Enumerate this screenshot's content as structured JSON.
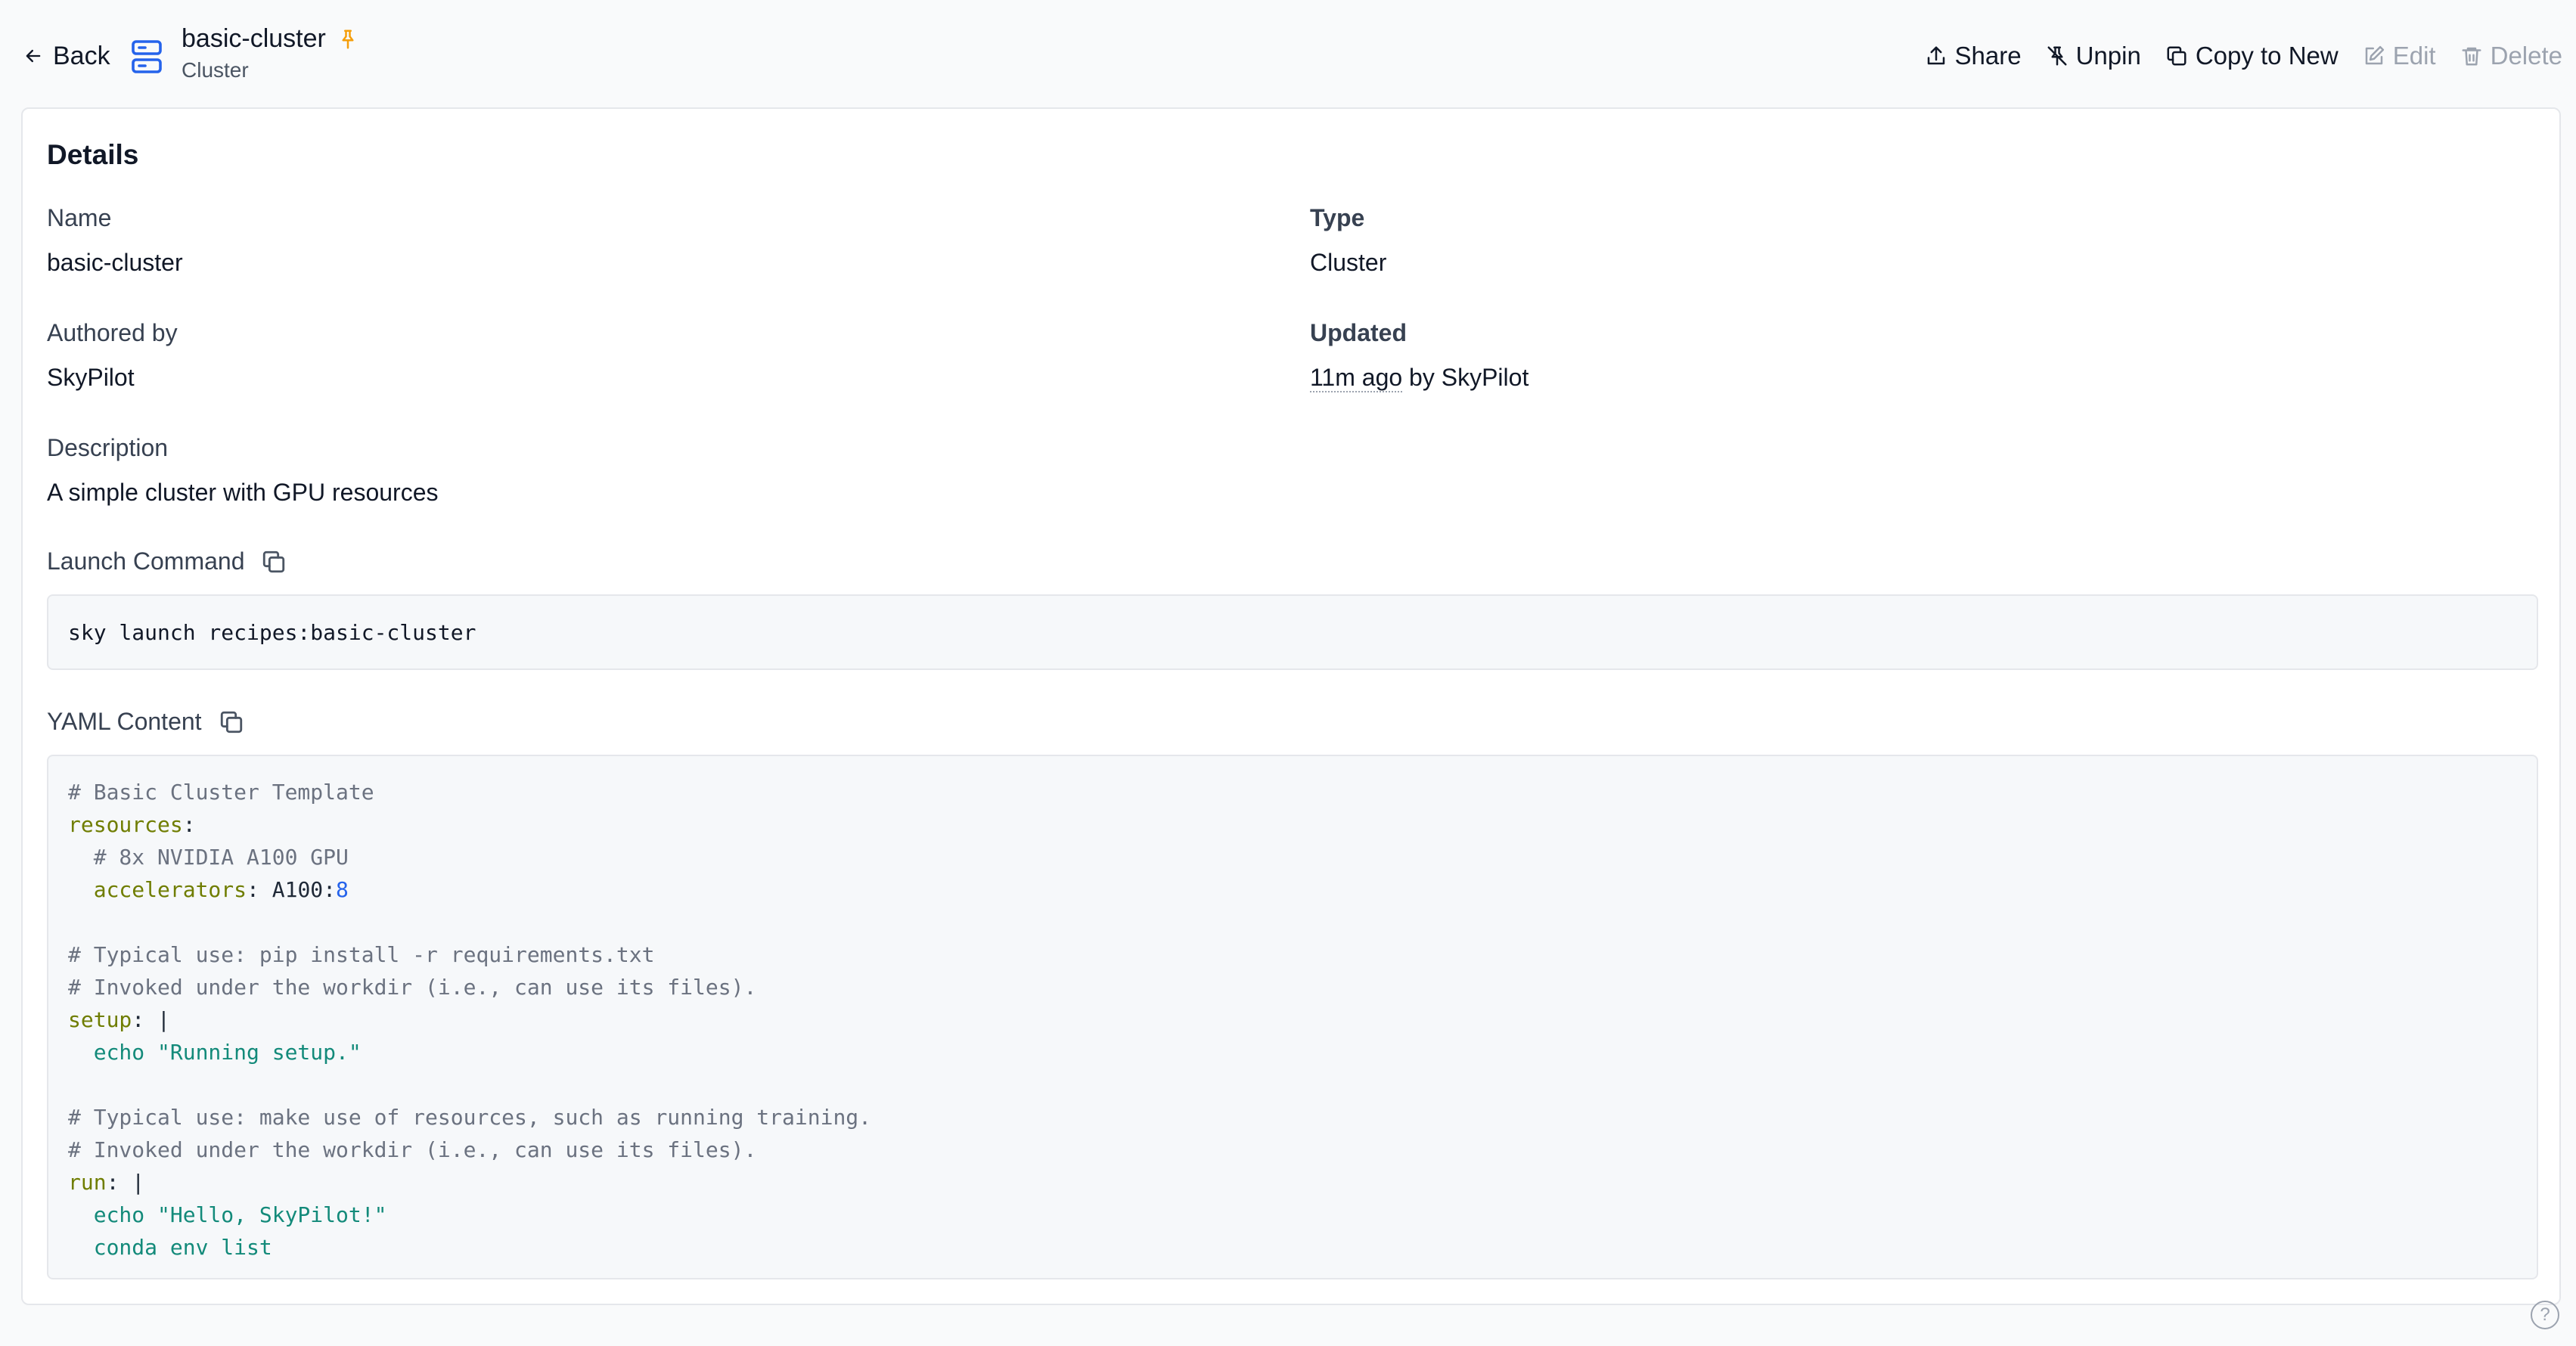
{
  "header": {
    "back_label": "Back",
    "title": "basic-cluster",
    "subtitle": "Cluster",
    "resource_icon": "server-stack-icon",
    "pin_icon": "pin-icon",
    "pin_color": "#f59e0b"
  },
  "actions": {
    "share": "Share",
    "unpin": "Unpin",
    "copy_to_new": "Copy to New",
    "edit": "Edit",
    "delete": "Delete"
  },
  "details": {
    "heading": "Details",
    "name_label": "Name",
    "name_value": "basic-cluster",
    "type_label": "Type",
    "type_value": "Cluster",
    "authored_label": "Authored by",
    "authored_value": "SkyPilot",
    "updated_label": "Updated",
    "updated_time": "11m ago",
    "updated_by": " by SkyPilot",
    "description_label": "Description",
    "description_value": "A simple cluster with GPU resources"
  },
  "launch": {
    "label": "Launch Command",
    "command": "sky launch recipes:basic-cluster"
  },
  "yaml": {
    "label": "YAML Content",
    "lines": [
      [
        {
          "t": "# Basic Cluster Template",
          "c": "comment"
        }
      ],
      [
        {
          "t": "resources",
          "c": "key"
        },
        {
          "t": ":",
          "c": "plain"
        }
      ],
      [
        {
          "t": "  # 8x NVIDIA A100 GPU",
          "c": "comment"
        }
      ],
      [
        {
          "t": "  accelerators",
          "c": "key"
        },
        {
          "t": ": A100:",
          "c": "plain"
        },
        {
          "t": "8",
          "c": "num"
        }
      ],
      [
        {
          "t": "",
          "c": "plain"
        }
      ],
      [
        {
          "t": "# Typical use: pip install -r requirements.txt",
          "c": "comment"
        }
      ],
      [
        {
          "t": "# Invoked under the workdir (i.e., can use its files).",
          "c": "comment"
        }
      ],
      [
        {
          "t": "setup",
          "c": "key"
        },
        {
          "t": ": |",
          "c": "plain"
        }
      ],
      [
        {
          "t": "  echo \"Running setup.\"",
          "c": "str"
        }
      ],
      [
        {
          "t": "",
          "c": "plain"
        }
      ],
      [
        {
          "t": "# Typical use: make use of resources, such as running training.",
          "c": "comment"
        }
      ],
      [
        {
          "t": "# Invoked under the workdir (i.e., can use its files).",
          "c": "comment"
        }
      ],
      [
        {
          "t": "run",
          "c": "key"
        },
        {
          "t": ": |",
          "c": "plain"
        }
      ],
      [
        {
          "t": "  echo \"Hello, SkyPilot!\"",
          "c": "str"
        }
      ],
      [
        {
          "t": "  conda env list",
          "c": "str"
        }
      ]
    ]
  },
  "help": {
    "label": "?"
  }
}
